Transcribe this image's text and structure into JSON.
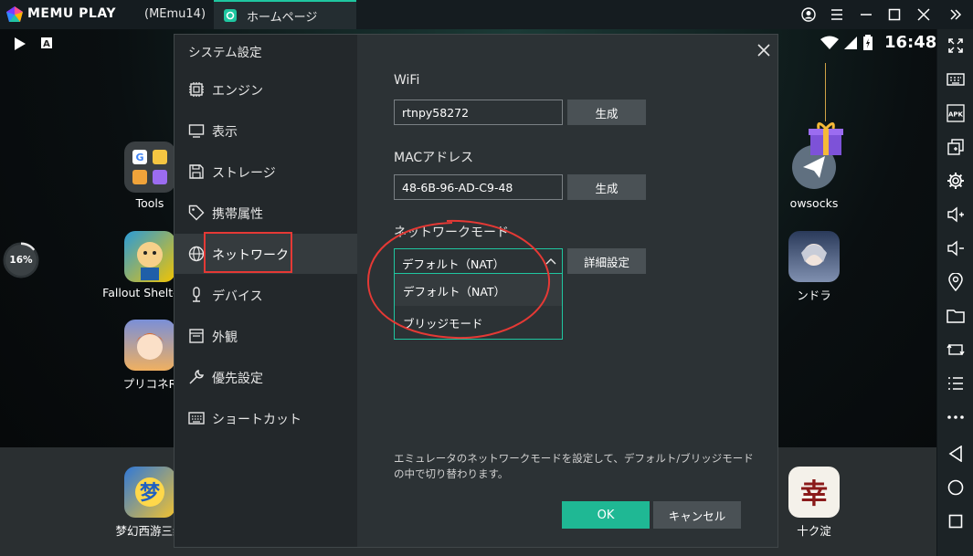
{
  "titlebar": {
    "brand": "MEMU PLAY",
    "instance": "(MEmu14)",
    "tab_label": "ホームページ",
    "icons": [
      "account-icon",
      "menu-icon",
      "minimize-icon",
      "maximize-icon",
      "close-icon",
      "collapse-icon"
    ]
  },
  "statusbar": {
    "time": "16:48",
    "icons": [
      "play-store-icon",
      "notification-a-icon",
      "wifi-icon",
      "signal-icon",
      "battery-icon"
    ]
  },
  "desktop": {
    "cpu_badge": "16%",
    "apps": [
      {
        "label": "Tools"
      },
      {
        "label": "Fallout Shelter O"
      },
      {
        "label": "プリコネR"
      },
      {
        "label": "梦幻西游三维"
      },
      {
        "label": "owsocks"
      },
      {
        "label": "ンドラ"
      },
      {
        "label": "十ク淀"
      }
    ]
  },
  "dialog": {
    "title": "システム設定",
    "nav": [
      {
        "label": "エンジン",
        "icon": "cpu-icon"
      },
      {
        "label": "表示",
        "icon": "monitor-icon"
      },
      {
        "label": "ストレージ",
        "icon": "save-icon"
      },
      {
        "label": "携帯属性",
        "icon": "tag-icon"
      },
      {
        "label": "ネットワーク",
        "icon": "globe-icon"
      },
      {
        "label": "デバイス",
        "icon": "microphone-icon"
      },
      {
        "label": "外観",
        "icon": "window-icon"
      },
      {
        "label": "優先設定",
        "icon": "wrench-icon"
      },
      {
        "label": "ショートカット",
        "icon": "keyboard-icon"
      }
    ],
    "active_nav": "ネットワーク",
    "wifi": {
      "label": "WiFi",
      "value": "rtnpy58272",
      "button": "生成"
    },
    "mac": {
      "label": "MACアドレス",
      "value": "48-6B-96-AD-C9-48",
      "button": "生成"
    },
    "network_mode": {
      "label": "ネットワークモード",
      "selected": "デフォルト（NAT）",
      "detail_button": "詳細設定",
      "options": [
        "デフォルト（NAT）",
        "ブリッジモード"
      ]
    },
    "description": "エミュレータのネットワークモードを設定して、デフォルト/ブリッジモードの中で切り替わります。",
    "ok": "OK",
    "cancel": "キャンセル"
  },
  "sidebar": {
    "icons": [
      "fullscreen-icon",
      "keyboard-icon",
      "apk-icon",
      "multi-window-icon",
      "settings-icon",
      "volume-up-icon",
      "volume-down-icon",
      "location-icon",
      "folder-icon",
      "rotate-icon",
      "list-icon",
      "more-icon",
      "back-icon",
      "home-icon",
      "recent-apps-icon"
    ],
    "apk_text": "APK"
  },
  "colors": {
    "accent": "#1fc6a0",
    "highlight_red": "#e53935",
    "dialog_bg": "#2c3235",
    "nav_bg": "#23282b"
  }
}
